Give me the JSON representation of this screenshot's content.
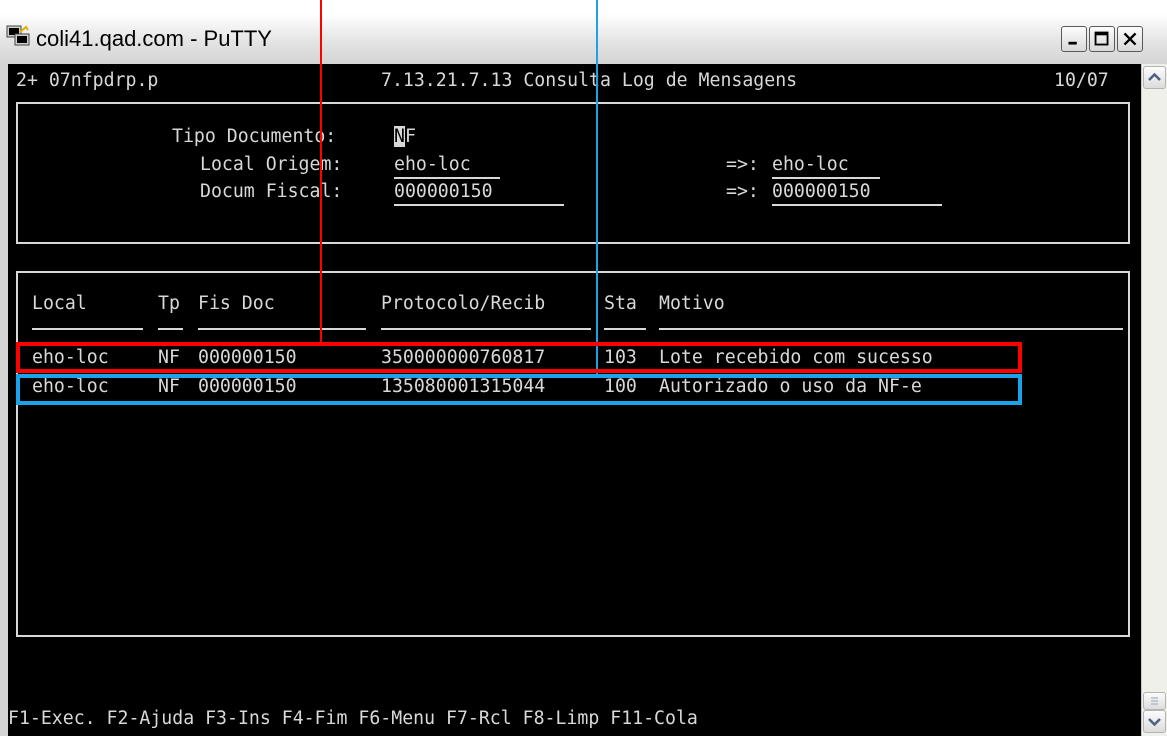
{
  "window": {
    "title": "coli41.qad.com - PuTTY",
    "icon": "putty-terminal-icon"
  },
  "terminal": {
    "header": {
      "left": "2+ 07nfpdrp.p",
      "center": "7.13.21.7.13 Consulta Log de Mensagens",
      "right": "10/07"
    },
    "form": {
      "tipo_documento_label": "Tipo Documento:",
      "tipo_documento_value": "NF",
      "local_origem_label": "Local Origem:",
      "local_origem_value": "eho-loc",
      "local_origem_to_label": "=>:",
      "local_origem_to_value": "eho-loc",
      "docum_fiscal_label": "Docum Fiscal:",
      "docum_fiscal_value": "000000150",
      "docum_fiscal_to_label": "=>:",
      "docum_fiscal_to_value": "000000150"
    },
    "table": {
      "headers": [
        "Local",
        "Tp",
        "Fis Doc",
        "Protocolo/Recib",
        "Sta",
        "Motivo"
      ],
      "rows": [
        {
          "local": "eho-loc",
          "tp": "NF",
          "fis_doc": "000000150",
          "protocolo": "350000000760817",
          "sta": "103",
          "motivo": "Lote recebido com sucesso"
        },
        {
          "local": "eho-loc",
          "tp": "NF",
          "fis_doc": "000000150",
          "protocolo": "135080001315044",
          "sta": "100",
          "motivo": "Autorizado o uso da NF-e"
        }
      ]
    },
    "function_keys": "F1-Exec. F2-Ajuda F3-Ins F4-Fim F6-Menu F7-Rcl F8-Limp F11-Cola"
  },
  "colors": {
    "highlight_row_1": "#ff0000",
    "highlight_row_2": "#1aa3e8",
    "terminal_bg": "#000000",
    "terminal_fg": "#d8d8d8"
  }
}
